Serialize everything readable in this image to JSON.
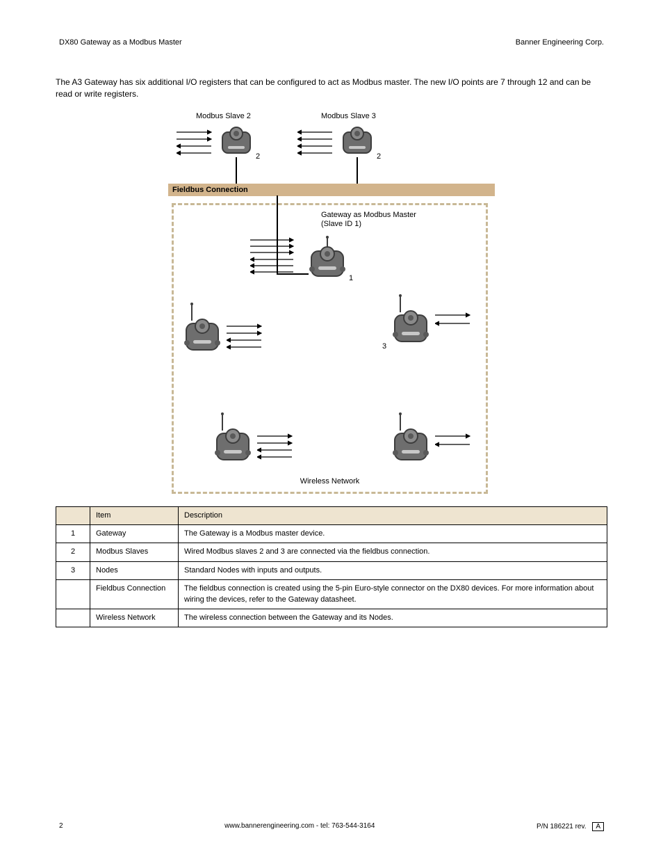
{
  "header": {
    "left": "DX80 Gateway as a Modbus Master",
    "right": "Banner Engineering Corp."
  },
  "intro": "The A3 Gateway has six additional I/O registers that can be configured to act as Modbus master. The new I/O points are 7 through 12 and can be read or write registers.",
  "diagram": {
    "modbus_slave_2": "Modbus Slave 2",
    "modbus_slave_3": "Modbus Slave 3",
    "fieldbus": "Fieldbus Connection",
    "gateway_label_1": "Gateway as Modbus Master",
    "gateway_label_2": "(Slave ID 1)",
    "wireless": "Wireless Network",
    "num1": "1",
    "num2a": "2",
    "num2b": "2",
    "num3": "3"
  },
  "table": {
    "headers": {
      "item": "Item",
      "desc": "Description"
    },
    "rows": [
      {
        "n": "1",
        "label": "Gateway",
        "desc": "The Gateway is a Modbus master device."
      },
      {
        "n": "2",
        "label": "Modbus Slaves",
        "desc": "Wired Modbus slaves 2 and 3 are connected via the fieldbus connection."
      },
      {
        "n": "3",
        "label": "Nodes",
        "desc": "Standard Nodes with inputs and outputs."
      },
      {
        "n": "",
        "label": "Fieldbus Connection",
        "desc": "The fieldbus connection is created using the 5-pin Euro-style connector on the DX80 devices. For more information about wiring the devices, refer to the Gateway datasheet."
      },
      {
        "n": "",
        "label": "Wireless Network",
        "desc": "The wireless connection between the Gateway and its Nodes."
      }
    ]
  },
  "footer": {
    "left": "2",
    "center": "www.bannerengineering.com - tel: 763-544-3164",
    "right_prefix": "P/N 186221 rev.",
    "rev": "A"
  }
}
